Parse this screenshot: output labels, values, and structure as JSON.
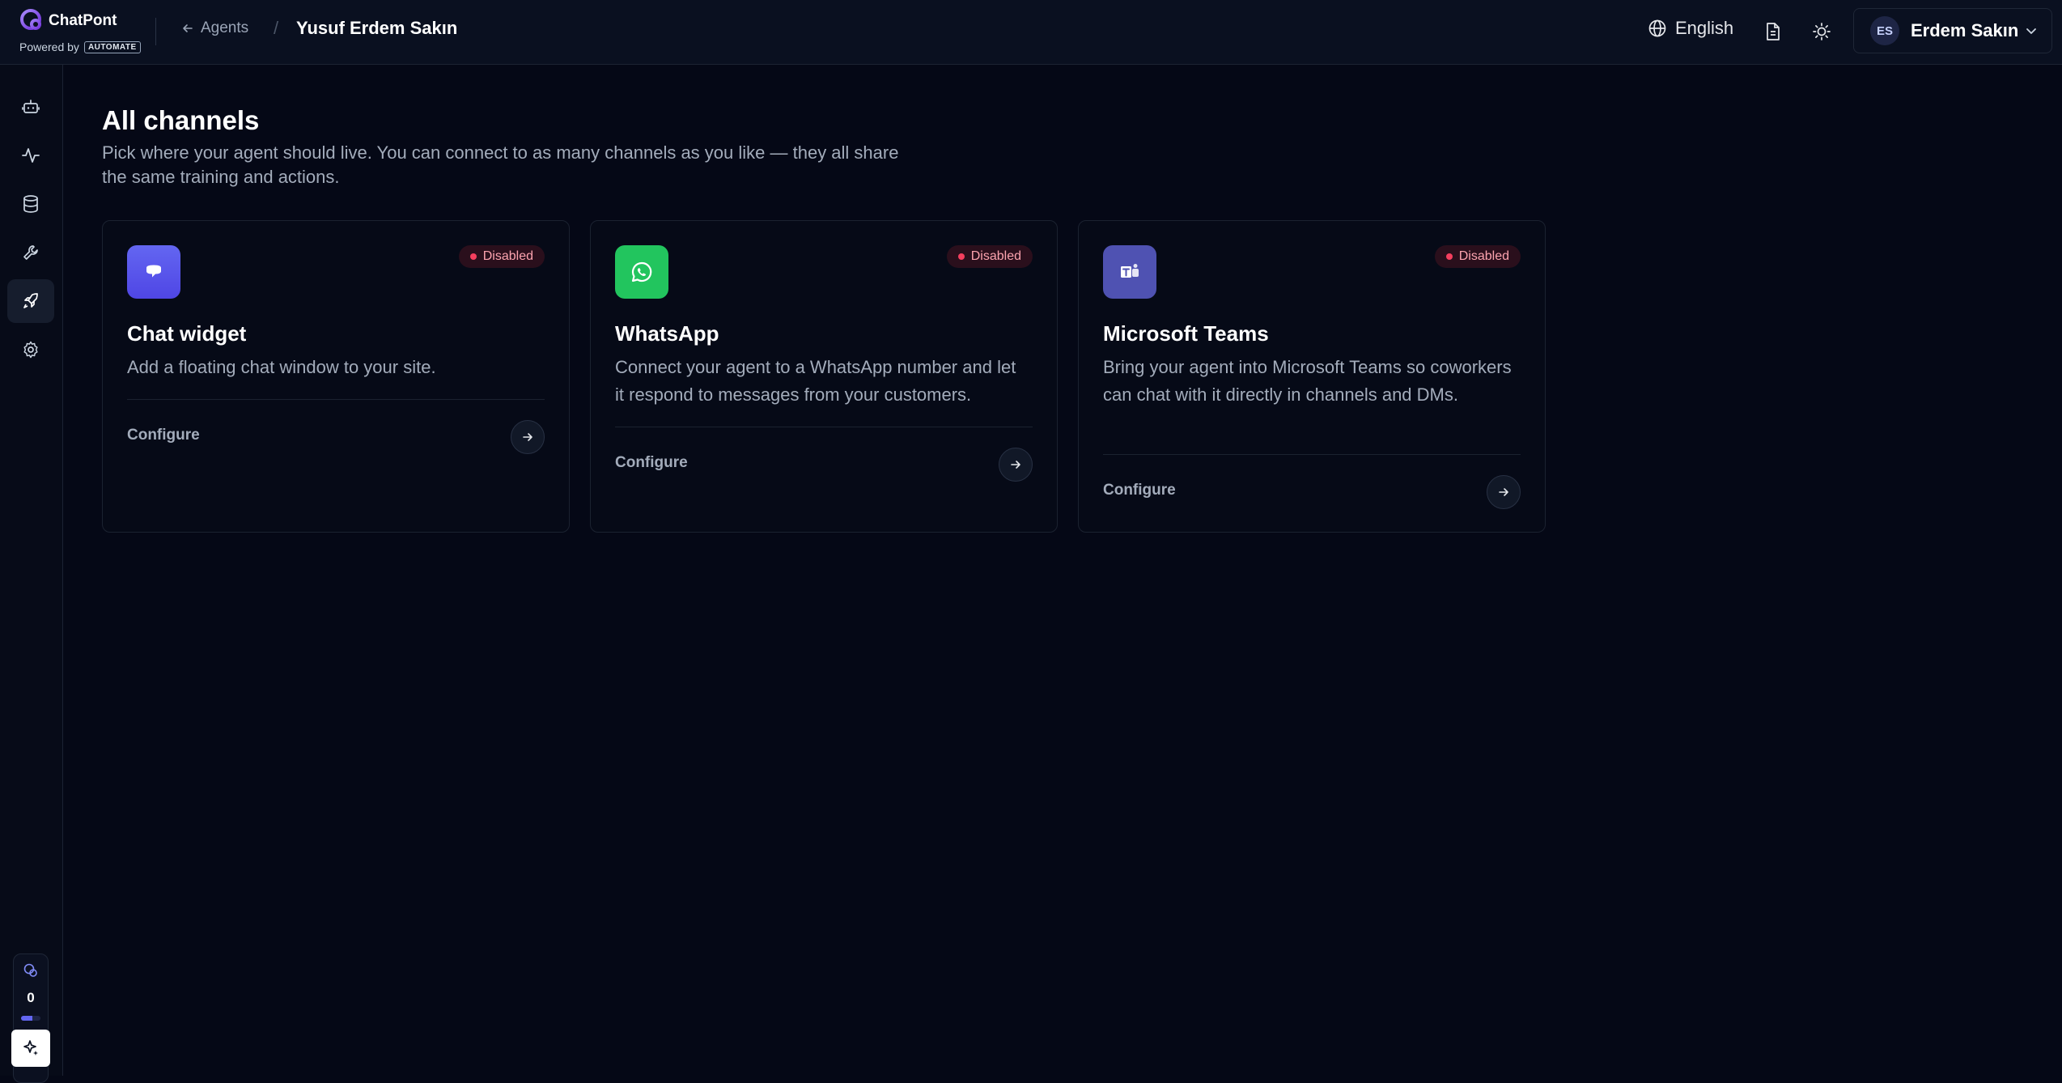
{
  "header": {
    "brand_name": "ChatPont",
    "powered_by": "Powered by",
    "powered_logo_text": "AUTOMATE",
    "back_label": "Agents",
    "breadcrumb_separator": "/",
    "current_agent": "Yusuf Erdem Sakın",
    "language": "English",
    "user_initials": "ES",
    "user_name": "Erdem Sakın"
  },
  "sidebar": {
    "items": [
      {
        "icon": "bot-icon",
        "active": false
      },
      {
        "icon": "activity-icon",
        "active": false
      },
      {
        "icon": "database-icon",
        "active": false
      },
      {
        "icon": "wrench-icon",
        "active": false
      },
      {
        "icon": "rocket-icon",
        "active": true
      },
      {
        "icon": "gear-icon",
        "active": false
      }
    ],
    "usage_count": "0",
    "usage_fraction": 0.6
  },
  "main": {
    "title": "All channels",
    "description": "Pick where your agent should live. You can connect to as many channels as you like — they all share the same training and actions.",
    "channels": [
      {
        "title": "Chat widget",
        "description": "Add a floating chat window to your site.",
        "status": "Disabled",
        "configure_label": "Configure",
        "icon": "chat-bubble-icon",
        "color": "#5b5bd6"
      },
      {
        "title": "WhatsApp",
        "description": "Connect your agent to a WhatsApp number and let it respond to messages from your customers.",
        "status": "Disabled",
        "configure_label": "Configure",
        "icon": "whatsapp-icon",
        "color": "#22c55e"
      },
      {
        "title": "Microsoft Teams",
        "description": "Bring your agent into Microsoft Teams so coworkers can chat with it directly in channels and DMs.",
        "status": "Disabled",
        "configure_label": "Configure",
        "icon": "teams-icon",
        "color": "#4f52b2"
      }
    ]
  },
  "colors": {
    "background": "#050816",
    "disabled_badge": "#f43f5e",
    "accent": "#6366f1"
  }
}
